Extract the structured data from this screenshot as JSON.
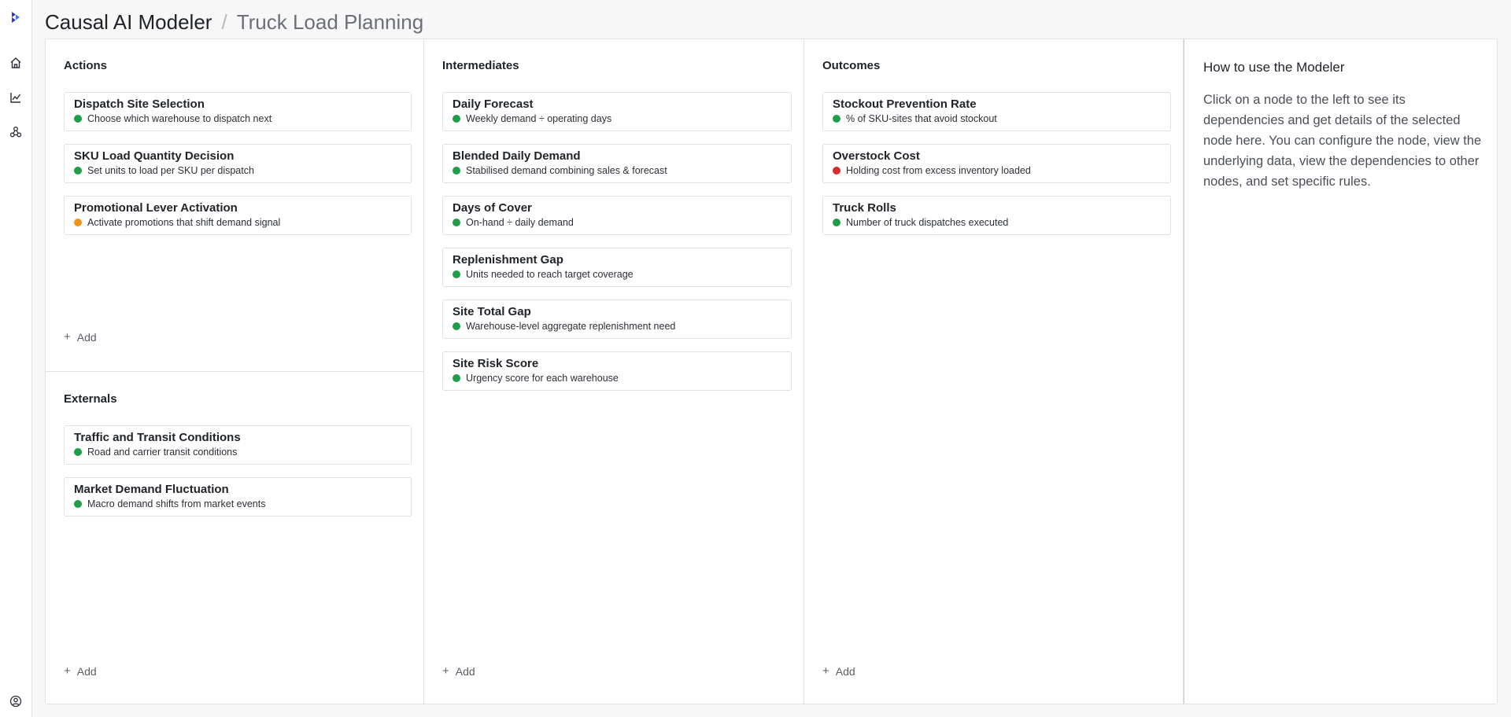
{
  "app": {
    "title": "Causal AI Modeler",
    "separator": "/",
    "model_name": "Truck Load Planning"
  },
  "colors": {
    "green": "#1f9d49",
    "orange": "#f0941a",
    "red": "#d92b2b"
  },
  "rail": {
    "icons": [
      "logo-icon",
      "home-icon",
      "chart-icon",
      "network-icon",
      "user-icon"
    ]
  },
  "actions": {
    "title": "Actions",
    "add_label": "Add",
    "items": [
      {
        "title": "Dispatch Site Selection",
        "desc": "Choose which warehouse to dispatch next",
        "status": "green"
      },
      {
        "title": "SKU Load Quantity Decision",
        "desc": "Set units to load per SKU per dispatch",
        "status": "green"
      },
      {
        "title": "Promotional Lever Activation",
        "desc": "Activate promotions that shift demand signal",
        "status": "orange"
      }
    ]
  },
  "externals": {
    "title": "Externals",
    "add_label": "Add",
    "items": [
      {
        "title": "Traffic and Transit Conditions",
        "desc": "Road and carrier transit conditions",
        "status": "green"
      },
      {
        "title": "Market Demand Fluctuation",
        "desc": "Macro demand shifts from market events",
        "status": "green"
      }
    ]
  },
  "intermediates": {
    "title": "Intermediates",
    "add_label": "Add",
    "items": [
      {
        "title": "Daily Forecast",
        "desc": "Weekly demand ÷ operating days",
        "status": "green"
      },
      {
        "title": "Blended Daily Demand",
        "desc": "Stabilised demand combining sales & forecast",
        "status": "green"
      },
      {
        "title": "Days of Cover",
        "desc": "On-hand ÷ daily demand",
        "status": "green"
      },
      {
        "title": "Replenishment Gap",
        "desc": "Units needed to reach target coverage",
        "status": "green"
      },
      {
        "title": "Site Total Gap",
        "desc": "Warehouse-level aggregate replenishment need",
        "status": "green"
      },
      {
        "title": "Site Risk Score",
        "desc": "Urgency score for each warehouse",
        "status": "green"
      }
    ]
  },
  "outcomes": {
    "title": "Outcomes",
    "add_label": "Add",
    "items": [
      {
        "title": "Stockout Prevention Rate",
        "desc": "% of SKU-sites that avoid stockout",
        "status": "green"
      },
      {
        "title": "Overstock Cost",
        "desc": "Holding cost from excess inventory loaded",
        "status": "red"
      },
      {
        "title": "Truck Rolls",
        "desc": "Number of truck dispatches executed",
        "status": "green"
      }
    ]
  },
  "help": {
    "title": "How to use the Modeler",
    "body": "Click on a node to the left to see its dependencies and get details of the selected node here. You can configure the node, view the underlying data, view the dependencies to other nodes, and set specific rules."
  }
}
